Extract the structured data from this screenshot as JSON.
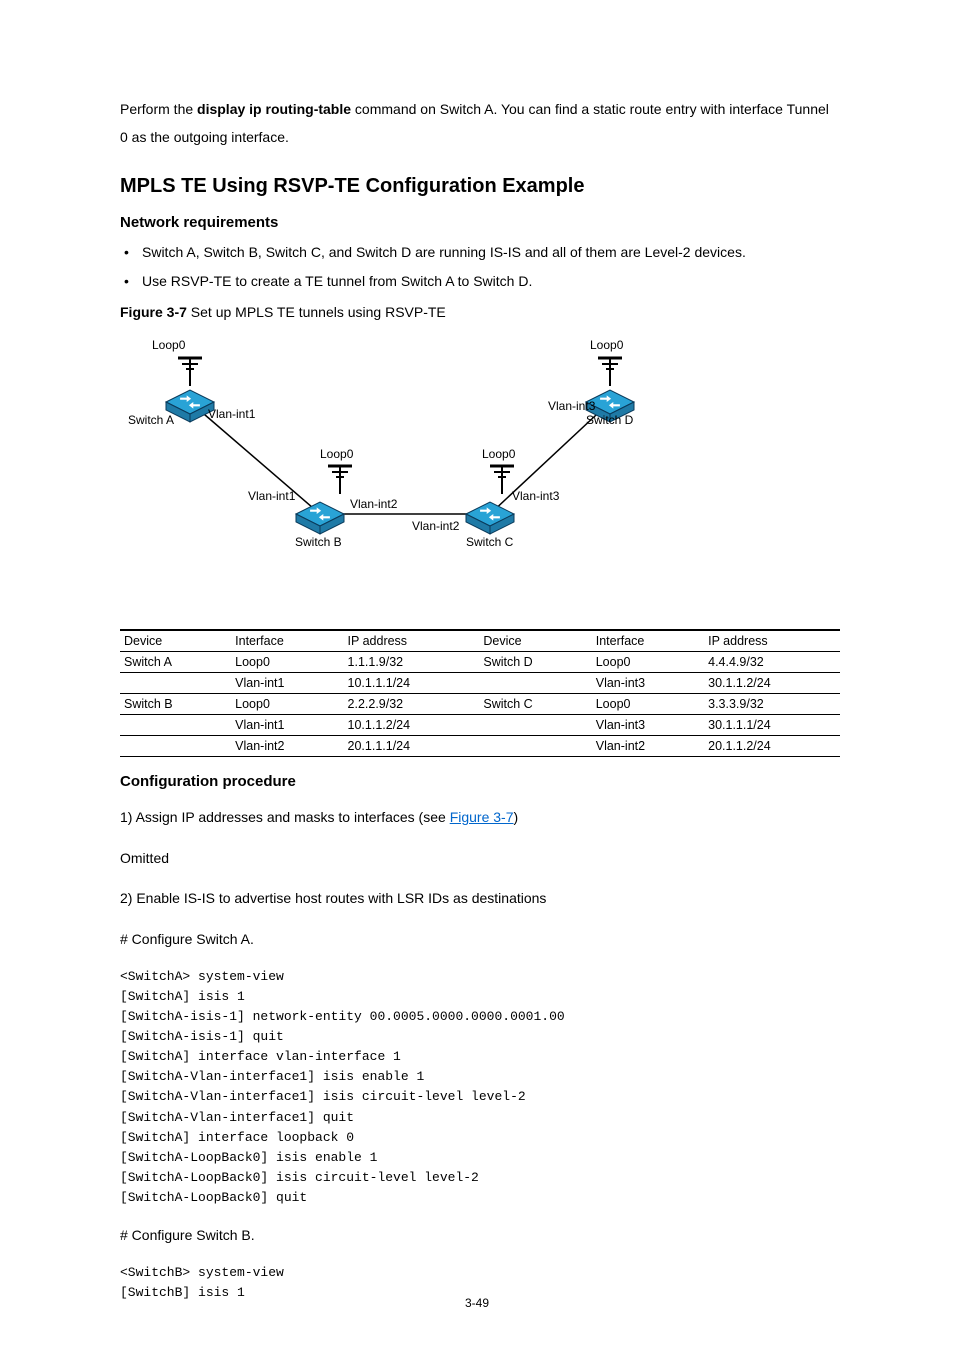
{
  "intro": {
    "line1_a": "Perform the ",
    "line1_b": "display ip routing-table",
    "line1_c": " command on Switch A. You can find a static route entry with interface Tunnel 0 as the outgoing interface."
  },
  "section_title": "MPLS TE Using RSVP-TE Configuration Example",
  "network_req_title": "Network requirements",
  "reqs": [
    "Switch A, Switch B, Switch C, and Switch D are running IS-IS and all of them are Level-2 devices.",
    "Use RSVP-TE to create a TE tunnel from Switch A to Switch D."
  ],
  "figure": {
    "num": "Figure 3-7",
    "caption": "Set up MPLS TE tunnels using RSVP-TE",
    "labels": {
      "loop0": "Loop0",
      "switchA": "Switch A",
      "switchB": "Switch B",
      "switchC": "Switch C",
      "switchD": "Switch D",
      "vlan1": "Vlan-int1",
      "vlan2": "Vlan-int2",
      "vlan3": "Vlan-int3"
    }
  },
  "table": {
    "headers": [
      "Device",
      "Interface",
      "IP address",
      "Device",
      "Interface",
      "IP address"
    ],
    "rows": [
      [
        "Switch A",
        "Loop0",
        "1.1.1.9/32",
        "Switch D",
        "Loop0",
        "4.4.4.9/32"
      ],
      [
        "",
        "Vlan-int1",
        "10.1.1.1/24",
        "",
        "Vlan-int3",
        "30.1.1.2/24"
      ],
      [
        "Switch B",
        "Loop0",
        "2.2.2.9/32",
        "Switch C",
        "Loop0",
        "3.3.3.9/32"
      ],
      [
        "",
        "Vlan-int1",
        "10.1.1.2/24",
        "",
        "Vlan-int3",
        "30.1.1.1/24"
      ],
      [
        "",
        "Vlan-int2",
        "20.1.1.1/24",
        "",
        "Vlan-int2",
        "20.1.1.2/24"
      ]
    ]
  },
  "config_title": "Configuration procedure",
  "steps": {
    "s1_a": "1)    Assign IP addresses and masks to interfaces (see ",
    "s1_link": "Figure 3-7",
    "s1_b": ")",
    "omitted": "Omitted",
    "s2": "2)    Enable IS-IS to advertise host routes with LSR IDs as destinations",
    "confA": "# Configure Switch A.",
    "cliA": "<SwitchA> system-view\n[SwitchA] isis 1\n[SwitchA-isis-1] network-entity 00.0005.0000.0000.0001.00\n[SwitchA-isis-1] quit\n[SwitchA] interface vlan-interface 1\n[SwitchA-Vlan-interface1] isis enable 1\n[SwitchA-Vlan-interface1] isis circuit-level level-2\n[SwitchA-Vlan-interface1] quit\n[SwitchA] interface loopback 0\n[SwitchA-LoopBack0] isis enable 1\n[SwitchA-LoopBack0] isis circuit-level level-2\n[SwitchA-LoopBack0] quit",
    "confB": "# Configure Switch B.",
    "cliB": "<SwitchB> system-view\n[SwitchB] isis 1"
  },
  "page_num": "3-49"
}
